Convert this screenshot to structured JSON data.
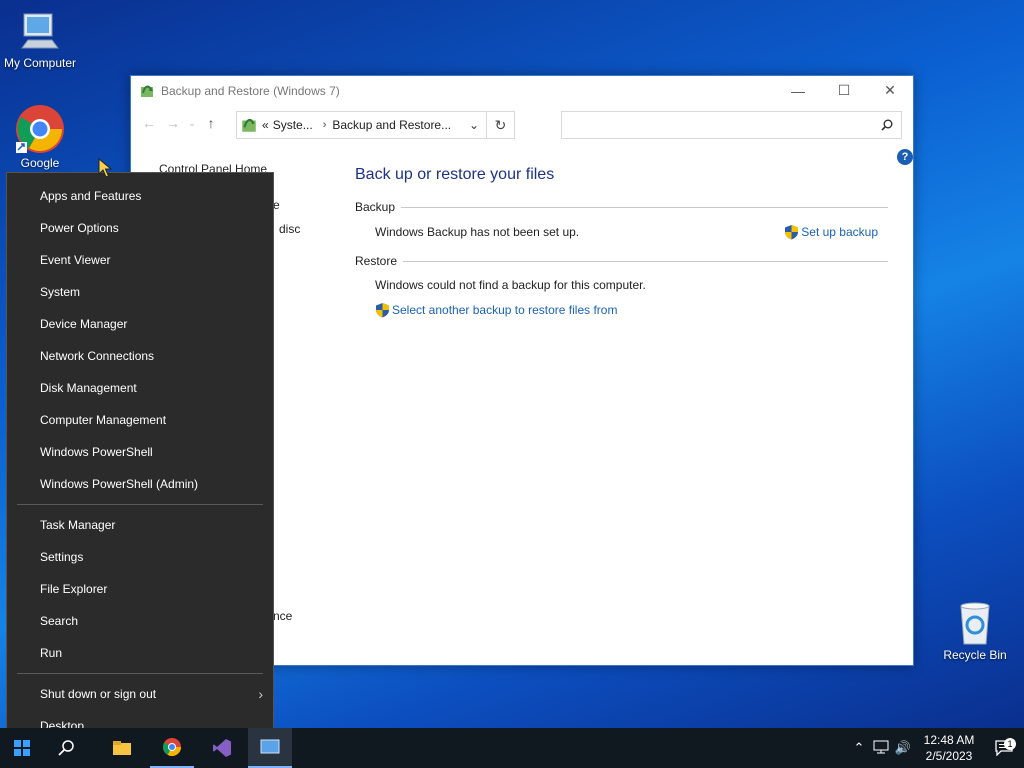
{
  "desktop": {
    "icons": [
      {
        "label": "My Computer",
        "icon": "computer-icon"
      },
      {
        "label": "Google",
        "icon": "chrome-icon"
      },
      {
        "label": "Recycle Bin",
        "icon": "recycle-bin-icon"
      }
    ]
  },
  "window": {
    "title": "Backup and Restore (Windows 7)",
    "address": {
      "chevrons": "«",
      "crumbs": [
        "Syste...",
        "Backup and Restore..."
      ]
    },
    "search": {
      "placeholder": ""
    },
    "help_label": "?",
    "left_pane": {
      "items": [
        "Control Panel Home",
        "e",
        "disc",
        "nce"
      ]
    },
    "main": {
      "title": "Back up or restore your files",
      "backup": {
        "heading": "Backup",
        "status": "Windows Backup has not been set up.",
        "action": "Set up backup"
      },
      "restore": {
        "heading": "Restore",
        "status": "Windows could not find a backup for this computer.",
        "action": "Select another backup to restore files from"
      }
    }
  },
  "context_menu": {
    "group1": [
      "Apps and Features",
      "Power Options",
      "Event Viewer",
      "System",
      "Device Manager",
      "Network Connections",
      "Disk Management",
      "Computer Management",
      "Windows PowerShell",
      "Windows PowerShell (Admin)"
    ],
    "group2": [
      "Task Manager",
      "Settings",
      "File Explorer",
      "Search",
      "Run"
    ],
    "group3": [
      "Shut down or sign out",
      "Desktop"
    ]
  },
  "taskbar": {
    "clock_time": "12:48 AM",
    "clock_date": "2/5/2023",
    "notification_count": "1"
  },
  "colors": {
    "link": "#1a62b8",
    "heading": "#1e3287",
    "menu_bg": "#2b2b2b",
    "taskbar_bg": "#101820"
  }
}
